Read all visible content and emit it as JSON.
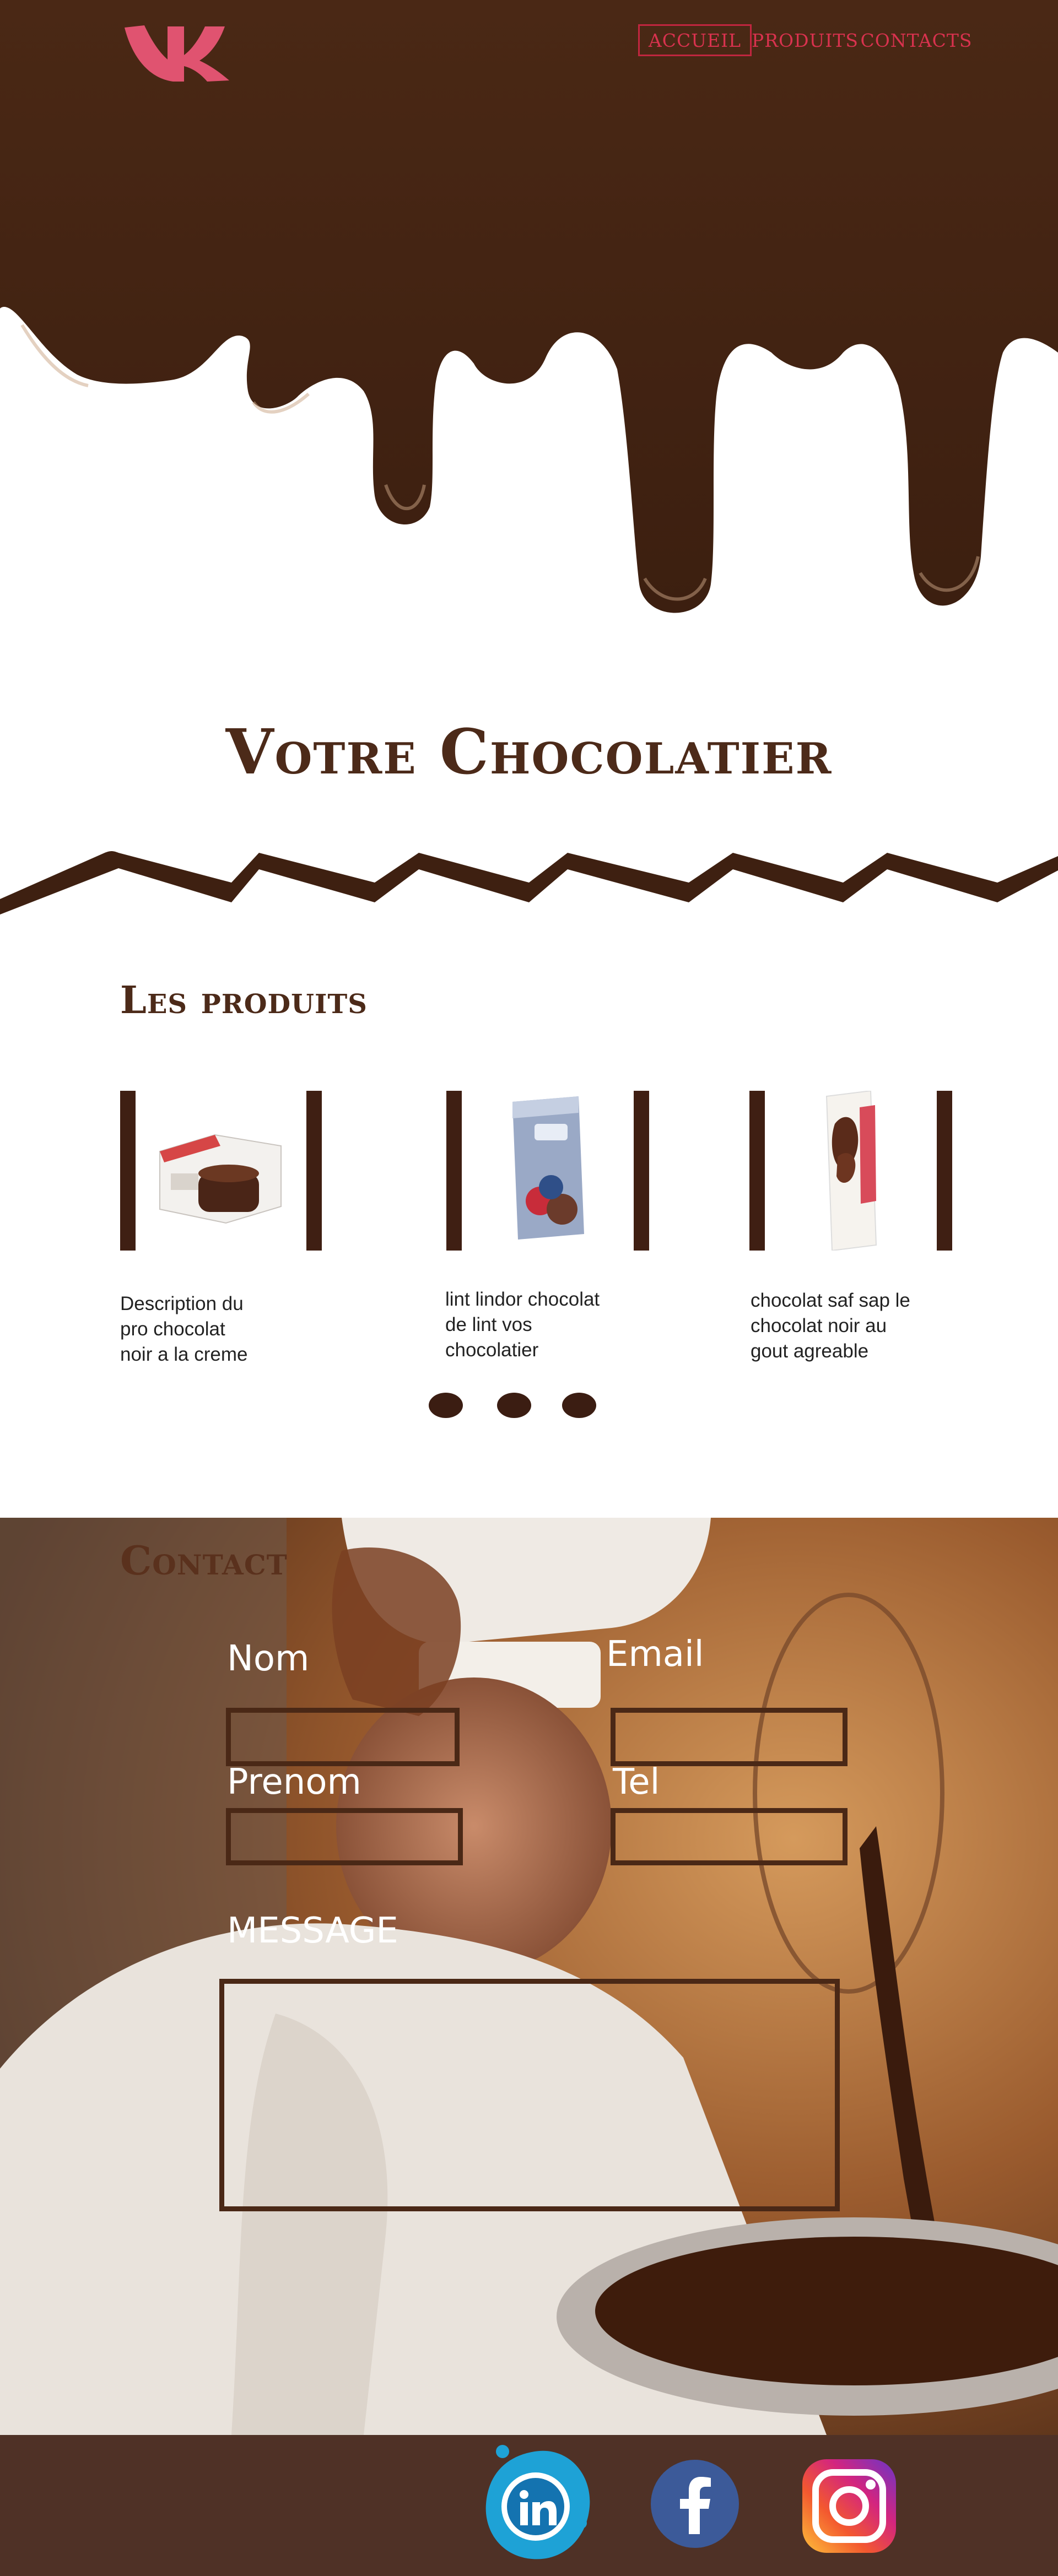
{
  "nav": {
    "items": [
      {
        "label": "ACCUEIL",
        "active": true
      },
      {
        "label": "PRODUITS",
        "active": false
      },
      {
        "label": "CONTACTS",
        "active": false
      }
    ]
  },
  "logo": {
    "icon": "vk-logo-icon",
    "color": "#e05370"
  },
  "hero": {
    "title": "Votre Chocolatier"
  },
  "products": {
    "title": "Les produits",
    "items": [
      {
        "description_lines": [
          "Description du",
          "pro chocolat",
          "noir a la creme"
        ]
      },
      {
        "description_lines": [
          "lint lindor chocolat",
          "de lint vos",
          "chocolatier"
        ]
      },
      {
        "description_lines": [
          "chocolat saf sap le",
          "chocolat noir au",
          "gout agreable"
        ]
      }
    ]
  },
  "contact": {
    "title": "Contact",
    "fields": {
      "nom": "Nom",
      "email": "Email",
      "prenom": "Prenom",
      "tel": "Tel",
      "message": "MESSAGE"
    }
  },
  "footer": {
    "social": [
      "linkedin-icon",
      "facebook-icon",
      "instagram-icon"
    ]
  },
  "colors": {
    "chocolate": "#4a2a1a",
    "accent": "#d8324e",
    "footer": "#4f3126"
  }
}
